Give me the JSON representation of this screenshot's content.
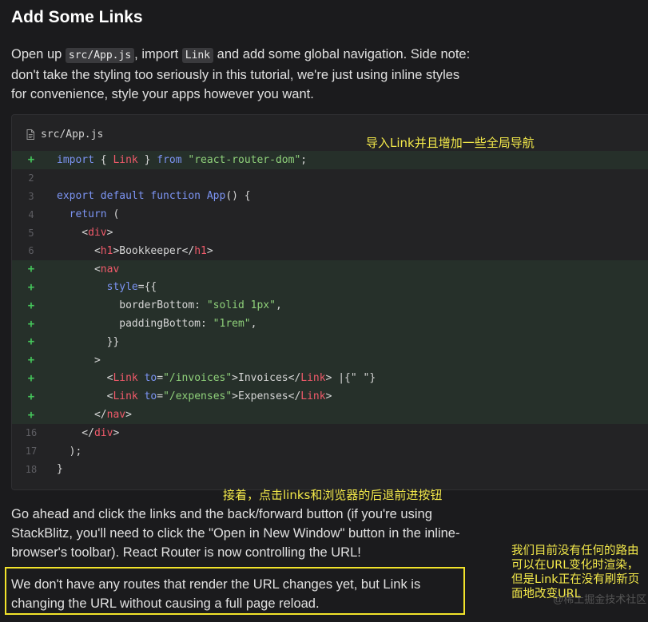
{
  "heading": "Add Some Links",
  "intro": {
    "part1": "Open up ",
    "code1": "src/App.js",
    "part2": ", import ",
    "code2": "Link",
    "part3": " and add some global navigation. Side note: don't take the styling too seriously in this tutorial, we're just using inline styles for convenience, style your apps however you want."
  },
  "code_block": {
    "filename": "src/App.js",
    "file_icon": "file-icon",
    "lines": [
      {
        "gutter": "+",
        "added": true,
        "tokens": [
          {
            "t": "import",
            "c": "kw"
          },
          {
            "t": " { ",
            "c": "pl"
          },
          {
            "t": "Link",
            "c": "tag"
          },
          {
            "t": " } ",
            "c": "pl"
          },
          {
            "t": "from",
            "c": "kw"
          },
          {
            "t": " ",
            "c": "pl"
          },
          {
            "t": "\"react-router-dom\"",
            "c": "str"
          },
          {
            "t": ";",
            "c": "pl"
          }
        ]
      },
      {
        "gutter": "2",
        "added": false,
        "tokens": []
      },
      {
        "gutter": "3",
        "added": false,
        "tokens": [
          {
            "t": "export default function",
            "c": "kw"
          },
          {
            "t": " ",
            "c": "pl"
          },
          {
            "t": "App",
            "c": "fn"
          },
          {
            "t": "() {",
            "c": "pl"
          }
        ]
      },
      {
        "gutter": "4",
        "added": false,
        "tokens": [
          {
            "t": "  ",
            "c": "pl"
          },
          {
            "t": "return",
            "c": "kw"
          },
          {
            "t": " (",
            "c": "pl"
          }
        ]
      },
      {
        "gutter": "5",
        "added": false,
        "tokens": [
          {
            "t": "    <",
            "c": "pl"
          },
          {
            "t": "div",
            "c": "tag"
          },
          {
            "t": ">",
            "c": "pl"
          }
        ]
      },
      {
        "gutter": "6",
        "added": false,
        "tokens": [
          {
            "t": "      <",
            "c": "pl"
          },
          {
            "t": "h1",
            "c": "tag"
          },
          {
            "t": ">Bookkeeper</",
            "c": "pl"
          },
          {
            "t": "h1",
            "c": "tag"
          },
          {
            "t": ">",
            "c": "pl"
          }
        ]
      },
      {
        "gutter": "+",
        "added": true,
        "tokens": [
          {
            "t": "      <",
            "c": "pl"
          },
          {
            "t": "nav",
            "c": "tag"
          }
        ]
      },
      {
        "gutter": "+",
        "added": true,
        "tokens": [
          {
            "t": "        ",
            "c": "pl"
          },
          {
            "t": "style",
            "c": "attr"
          },
          {
            "t": "={{",
            "c": "pl"
          }
        ]
      },
      {
        "gutter": "+",
        "added": true,
        "tokens": [
          {
            "t": "          borderBottom: ",
            "c": "pl"
          },
          {
            "t": "\"solid 1px\"",
            "c": "str"
          },
          {
            "t": ",",
            "c": "pl"
          }
        ]
      },
      {
        "gutter": "+",
        "added": true,
        "tokens": [
          {
            "t": "          paddingBottom: ",
            "c": "pl"
          },
          {
            "t": "\"1rem\"",
            "c": "str"
          },
          {
            "t": ",",
            "c": "pl"
          }
        ]
      },
      {
        "gutter": "+",
        "added": true,
        "tokens": [
          {
            "t": "        }}",
            "c": "pl"
          }
        ]
      },
      {
        "gutter": "+",
        "added": true,
        "tokens": [
          {
            "t": "      >",
            "c": "pl"
          }
        ]
      },
      {
        "gutter": "+",
        "added": true,
        "tokens": [
          {
            "t": "        <",
            "c": "pl"
          },
          {
            "t": "Link",
            "c": "tag"
          },
          {
            "t": " ",
            "c": "pl"
          },
          {
            "t": "to",
            "c": "attr"
          },
          {
            "t": "=",
            "c": "pl"
          },
          {
            "t": "\"/invoices\"",
            "c": "str"
          },
          {
            "t": ">Invoices</",
            "c": "pl"
          },
          {
            "t": "Link",
            "c": "tag"
          },
          {
            "t": "> |{\" \"}",
            "c": "pl"
          }
        ]
      },
      {
        "gutter": "+",
        "added": true,
        "tokens": [
          {
            "t": "        <",
            "c": "pl"
          },
          {
            "t": "Link",
            "c": "tag"
          },
          {
            "t": " ",
            "c": "pl"
          },
          {
            "t": "to",
            "c": "attr"
          },
          {
            "t": "=",
            "c": "pl"
          },
          {
            "t": "\"/expenses\"",
            "c": "str"
          },
          {
            "t": ">Expenses</",
            "c": "pl"
          },
          {
            "t": "Link",
            "c": "tag"
          },
          {
            "t": ">",
            "c": "pl"
          }
        ]
      },
      {
        "gutter": "+",
        "added": true,
        "tokens": [
          {
            "t": "      </",
            "c": "pl"
          },
          {
            "t": "nav",
            "c": "tag"
          },
          {
            "t": ">",
            "c": "pl"
          }
        ]
      },
      {
        "gutter": "16",
        "added": false,
        "tokens": [
          {
            "t": "    </",
            "c": "pl"
          },
          {
            "t": "div",
            "c": "tag"
          },
          {
            "t": ">",
            "c": "pl"
          }
        ]
      },
      {
        "gutter": "17",
        "added": false,
        "tokens": [
          {
            "t": "  );",
            "c": "pl"
          }
        ]
      },
      {
        "gutter": "18",
        "added": false,
        "tokens": [
          {
            "t": "}",
            "c": "pl"
          }
        ]
      }
    ]
  },
  "annotations": {
    "top": "导入Link并且增加一些全局导航",
    "middle": "接着，点击links和浏览器的后退前进按钮",
    "side": "我们目前没有任何的路由可以在URL变化时渲染，但是Link正在没有刷新页面地改变URL"
  },
  "para2": "Go ahead and click the links and the back/forward button (if you're using StackBlitz, you'll need to click the \"Open in New Window\" button in the inline-browser's toolbar). React Router is now controlling the URL!",
  "callout": "We don't have any routes that render the URL changes yet, but Link is changing the URL without causing a full page reload.",
  "watermark": "@稀土掘金技术社区",
  "colors": {
    "background": "#1b1b1d",
    "code_bg": "#232325",
    "added_line_bg": "#26302a",
    "plus_green": "#45c55b",
    "keyword_blue": "#7c94f3",
    "tag_red": "#f05a6a",
    "string_green": "#8fd17a",
    "annotation_yellow": "#f3e94a"
  }
}
